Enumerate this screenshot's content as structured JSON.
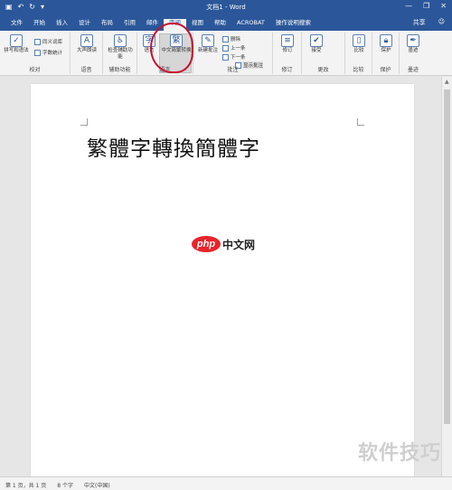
{
  "titlebar": {
    "title": "文档1 - Word",
    "qat": [
      "▣",
      "↶",
      "↻",
      "▾"
    ],
    "controls": [
      "—",
      "❐",
      "✕"
    ]
  },
  "tabs": [
    "文件",
    "开始",
    "插入",
    "设计",
    "布局",
    "引用",
    "邮件",
    "审阅",
    "视图",
    "帮助",
    "ACROBAT",
    "操作说明搜索"
  ],
  "active_tab_index": 7,
  "tabs_right": {
    "share": "共享",
    "smile": "☺"
  },
  "ribbon": {
    "proofing": {
      "label": "校对",
      "spelling": "拼写和语法",
      "thesaurus": "同义词库",
      "wordcount": "字数统计"
    },
    "speech": {
      "label": "语音",
      "read_aloud": "大声朗读"
    },
    "accessibility": {
      "label": "辅助功能",
      "check": "检查辅助功能"
    },
    "language": {
      "label": "语言",
      "btn": "语言"
    },
    "chinese": {
      "btn": "中文简繁转换"
    },
    "comments": {
      "label": "批注",
      "new": "新建批注",
      "delete": "删除",
      "prev": "上一条",
      "next": "下一条",
      "show": "显示批注"
    },
    "tracking": {
      "label": "修订",
      "btn": "修订"
    },
    "changes": {
      "label": "更改",
      "accept": "接受"
    },
    "compare": {
      "label": "比较",
      "btn": "比较"
    },
    "protect": {
      "label": "保护",
      "btn": "保护"
    },
    "ink": {
      "label": "墨迹",
      "btn": "墨迹"
    }
  },
  "document": {
    "text": "繁體字轉換簡體字",
    "watermark_logo": "php",
    "watermark_cn": "中文网"
  },
  "status": {
    "page": "第 1 页，共 1 页",
    "words": "8 个字",
    "lang": "中文(中国)"
  },
  "corner_watermark": "软件技巧"
}
